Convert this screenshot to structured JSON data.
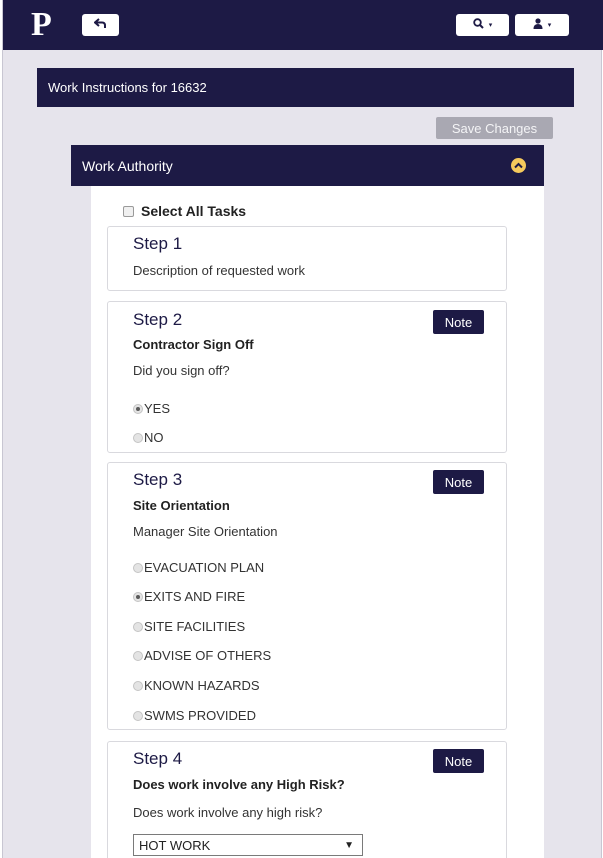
{
  "topbar": {
    "logo": "P",
    "back_icon": "undo-arrow-icon",
    "search_icon": "search-icon",
    "user_icon": "user-icon",
    "caret": "▾"
  },
  "header": {
    "title": "Work Instructions for 16632"
  },
  "toolbar": {
    "save_label": "Save Changes"
  },
  "panel": {
    "title": "Work Authority",
    "collapse_icon": "chevron-up-circle-icon",
    "select_all_label": "Select All Tasks",
    "select_all_checked": false
  },
  "steps": [
    {
      "title": "Step 1",
      "description": "Description of requested work"
    },
    {
      "title": "Step 2",
      "subtitle": "Contractor Sign Off",
      "question": "Did you sign off?",
      "note_label": "Note",
      "options": [
        {
          "label": "YES",
          "checked": true
        },
        {
          "label": "NO",
          "checked": false
        }
      ]
    },
    {
      "title": "Step 3",
      "subtitle": "Site Orientation",
      "question": "Manager Site Orientation",
      "note_label": "Note",
      "options": [
        {
          "label": "EVACUATION PLAN",
          "checked": false
        },
        {
          "label": "EXITS AND FIRE",
          "checked": true
        },
        {
          "label": "SITE FACILITIES",
          "checked": false
        },
        {
          "label": "ADVISE OF OTHERS",
          "checked": false
        },
        {
          "label": "KNOWN HAZARDS",
          "checked": false
        },
        {
          "label": "SWMS PROVIDED",
          "checked": false
        }
      ]
    },
    {
      "title": "Step 4",
      "subtitle": "Does work involve any High Risk?",
      "question": "Does work involve any high risk?",
      "note_label": "Note",
      "select_value": "HOT WORK",
      "select_arrow": "▼"
    }
  ],
  "colors": {
    "navy": "#1d1a45",
    "page_bg": "#e6e4ec",
    "accent_yellow": "#f5c95c",
    "save_disabled": "#a9a8b2"
  }
}
